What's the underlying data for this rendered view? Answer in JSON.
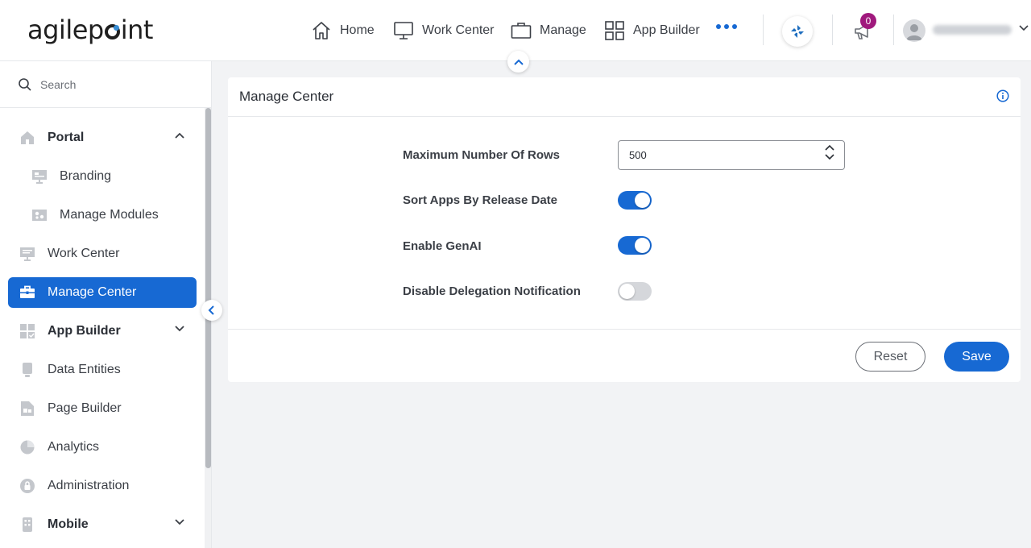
{
  "header": {
    "logo_text_a": "agilep",
    "logo_text_b": "int",
    "nav": [
      {
        "label": "Home",
        "icon": "home-icon"
      },
      {
        "label": "Work Center",
        "icon": "monitor-icon"
      },
      {
        "label": "Manage",
        "icon": "briefcase-icon"
      },
      {
        "label": "App Builder",
        "icon": "grid-icon"
      }
    ],
    "more_icon": "more-dots-icon",
    "notification_count": "0"
  },
  "sidebar": {
    "search_placeholder": "Search",
    "items": [
      {
        "label": "Portal",
        "icon": "home-icon",
        "expanded": true
      },
      {
        "label": "Branding",
        "icon": "branding-icon"
      },
      {
        "label": "Manage Modules",
        "icon": "modules-icon"
      },
      {
        "label": "Work Center",
        "icon": "monitor-icon"
      },
      {
        "label": "Manage Center",
        "icon": "briefcase-icon",
        "active": true
      },
      {
        "label": "App Builder",
        "icon": "grid-icon",
        "expanded": false
      },
      {
        "label": "Data Entities",
        "icon": "data-entities-icon"
      },
      {
        "label": "Page Builder",
        "icon": "page-builder-icon"
      },
      {
        "label": "Analytics",
        "icon": "pie-chart-icon"
      },
      {
        "label": "Administration",
        "icon": "lock-icon"
      },
      {
        "label": "Mobile",
        "icon": "mobile-icon",
        "expanded": false
      }
    ]
  },
  "main": {
    "title": "Manage Center",
    "fields": {
      "max_rows_label": "Maximum Number Of Rows",
      "max_rows_value": "500",
      "sort_label": "Sort Apps By Release Date",
      "sort_on": true,
      "genai_label": "Enable GenAI",
      "genai_on": true,
      "delegation_label": "Disable Delegation Notification",
      "delegation_on": false
    },
    "buttons": {
      "reset": "Reset",
      "save": "Save"
    }
  },
  "colors": {
    "accent": "#1769d3",
    "badge": "#a0197d"
  }
}
